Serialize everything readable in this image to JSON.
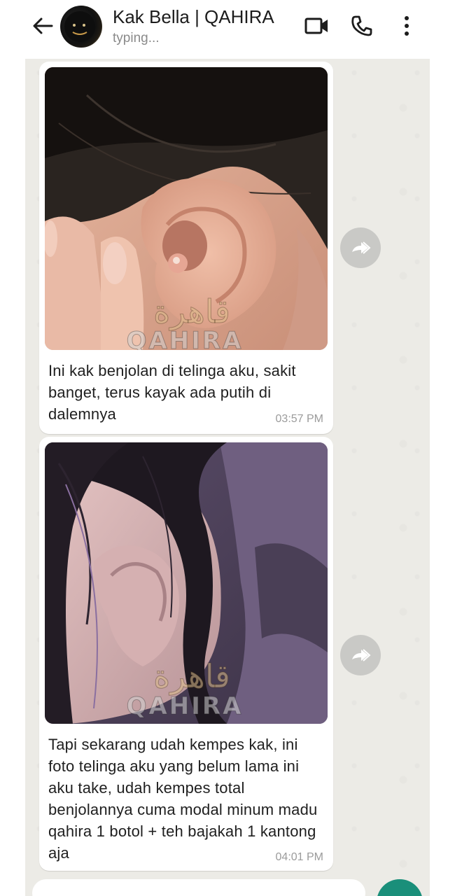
{
  "header": {
    "contact_name": "Kak Bella | QAHIRA",
    "status": "typing...",
    "icons": [
      "back-arrow-icon",
      "video-call-icon",
      "phone-icon",
      "more-vertical-icon"
    ]
  },
  "messages": [
    {
      "text": "Ini kak benjolan di telinga aku, sakit banget, terus kayak ada putih di dalemnya",
      "time": "03:57 PM",
      "watermark_ar": "قاهرة",
      "watermark_en": "QAHIRA"
    },
    {
      "text": "Tapi sekarang udah kempes kak, ini foto telinga aku yang belum lama ini aku take, udah kempes total benjolannya cuma modal minum madu qahira 1 botol + teh bajakah 1 kantong aja",
      "time": "04:01 PM",
      "watermark_ar": "قاهرة",
      "watermark_en": "QAHIRA"
    }
  ],
  "colors": {
    "chat_background": "#ecebe6",
    "bubble": "#ffffff",
    "forward_button": "#c9c9c6",
    "mic_button": "#1a8f7a"
  }
}
